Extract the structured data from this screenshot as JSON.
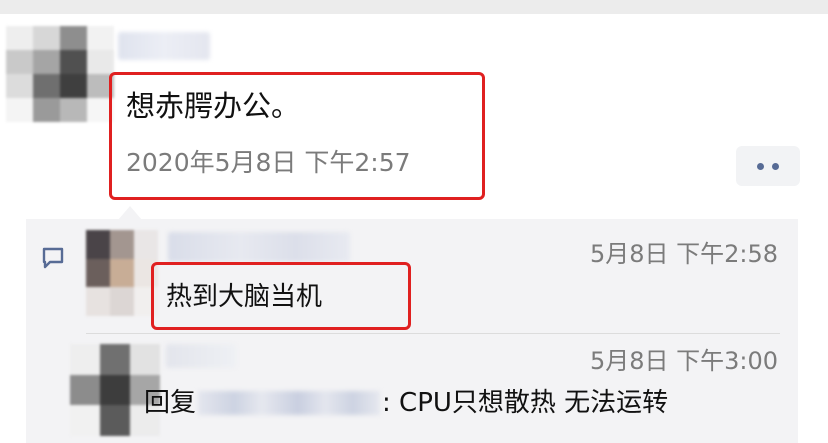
{
  "post": {
    "text": "想赤腭办公。",
    "time": "2020年5月8日 下午2:57"
  },
  "comments": [
    {
      "time": "5月8日 下午2:58",
      "text": "热到大脑当机"
    },
    {
      "time": "5月8日 下午3:00",
      "reply_prefix": "回复",
      "text": ": CPU只想散热 无法运转"
    }
  ],
  "colors": {
    "highlight_box": "#e02020",
    "link_blue": "#576b95",
    "comment_bg": "#f3f3f5",
    "secondary_text": "#7b7b7b"
  },
  "icons": {
    "more": "more-dots-icon",
    "comment": "comment-bubble-icon"
  }
}
